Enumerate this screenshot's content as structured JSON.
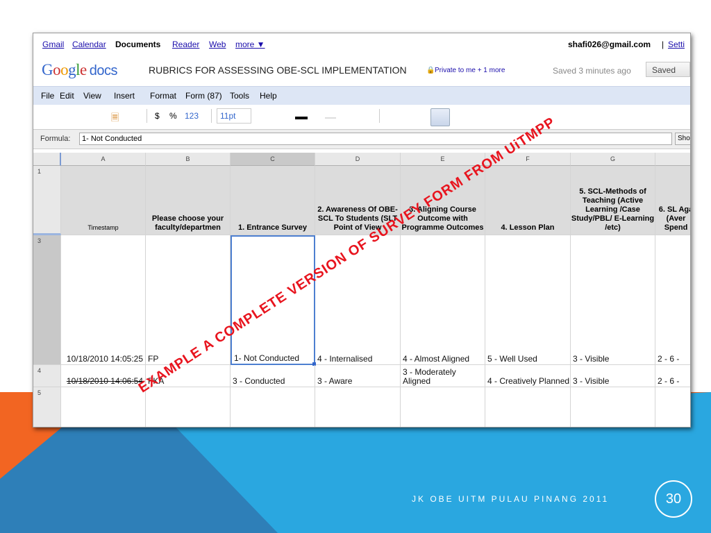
{
  "nav": {
    "links": [
      "Gmail",
      "Calendar",
      "Documents",
      "Reader",
      "Web",
      "more ▼"
    ],
    "user": "shafi026@gmail.com",
    "separator": "|",
    "settings": "Setti"
  },
  "header": {
    "logo_google": "Google",
    "logo_docs": "docs",
    "doc_title": "RUBRICS FOR ASSESSING OBE-SCL IMPLEMENTATION",
    "sharing": "Private to me + 1 more",
    "saved_text": "Saved 3 minutes ago",
    "saved_button": "Saved"
  },
  "menu": [
    "File",
    "Edit",
    "View",
    "Insert",
    "Format",
    "Form (87)",
    "Tools",
    "Help"
  ],
  "toolbar": {
    "dollar": "$",
    "percent": "%",
    "number": "123",
    "font_size": "11pt"
  },
  "formula": {
    "label": "Formula:",
    "value": "1- Not Conducted",
    "show_button": "Sho"
  },
  "columns": [
    "A",
    "B",
    "C",
    "D",
    "E",
    "F",
    "G",
    ""
  ],
  "rows": [
    "1",
    "3",
    "4",
    "5"
  ],
  "header_row": [
    "Timestamp",
    "Please choose your faculty/departmen",
    "1. Entrance Survey",
    "2. Awareness Of OBE-SCL To Students (SLT Point of View",
    "3. Aligning Course Outcome with Programme Outcomes",
    "4. Lesson Plan",
    "5. SCL-Methods of Teaching (Active Learning /Case Study/PBL/ E-Learning /etc)",
    "6. SL Aga (Aver Spend"
  ],
  "data_rows": [
    [
      "10/18/2010 14:05:25",
      "FP",
      "1- Not Conducted",
      "4 - Internalised",
      "4 - Almost Aligned",
      "5 - Well Used",
      "3 - Visible",
      "2 - 6 -"
    ],
    [
      "10/18/2010 14:06:54",
      "FKA",
      "3 - Conducted",
      "3 - Aware",
      "3 - Moderately Aligned",
      "4 - Creatively Planned",
      "3 - Visible",
      "2 - 6 -"
    ],
    [
      "",
      "",
      "",
      "",
      "",
      "",
      "",
      ""
    ]
  ],
  "watermark": "EXAMPLE A COMPLETE VERSION OF SURVEY FORM FROM UiTMPP",
  "slide": {
    "footer": "JK OBE UITM PULAU PINANG 2011",
    "page_number": "30"
  },
  "colors": {
    "orange": "#f26522",
    "blue": "#29a3dc",
    "dark_blue": "#2e7fb8",
    "watermark": "#e8141e"
  }
}
